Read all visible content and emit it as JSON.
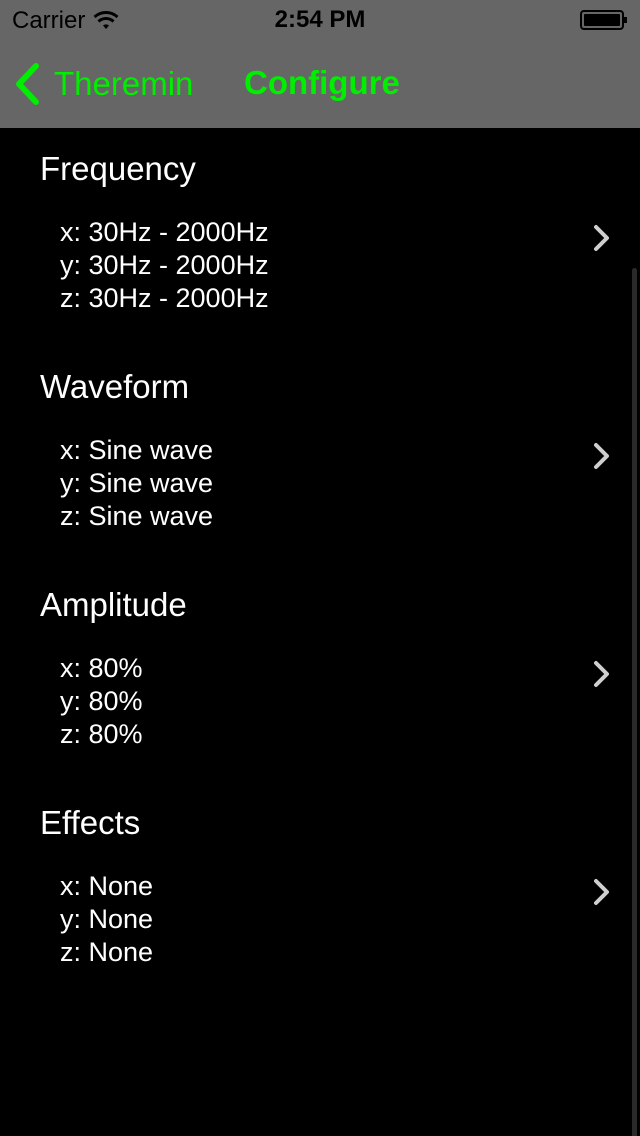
{
  "status_bar": {
    "carrier": "Carrier",
    "time": "2:54 PM"
  },
  "nav": {
    "back_label": "Theremin",
    "title": "Configure",
    "accent_color": "#00ee00"
  },
  "sections": [
    {
      "title": "Frequency",
      "lines": [
        "x: 30Hz - 2000Hz",
        "y: 30Hz - 2000Hz",
        "z: 30Hz - 2000Hz"
      ]
    },
    {
      "title": "Waveform",
      "lines": [
        "x: Sine wave",
        "y: Sine wave",
        "z: Sine wave"
      ]
    },
    {
      "title": "Amplitude",
      "lines": [
        "x: 80%",
        "y: 80%",
        "z: 80%"
      ]
    },
    {
      "title": "Effects",
      "lines": [
        "x: None",
        "y: None",
        "z: None"
      ]
    }
  ],
  "colors": {
    "background": "#000000",
    "nav_background": "#666666",
    "text": "#ffffff",
    "chevron": "#cfcfcf"
  },
  "icons": {
    "wifi": "wifi-icon",
    "battery": "battery-icon",
    "back": "chevron-left-icon",
    "disclosure": "chevron-right-icon"
  }
}
